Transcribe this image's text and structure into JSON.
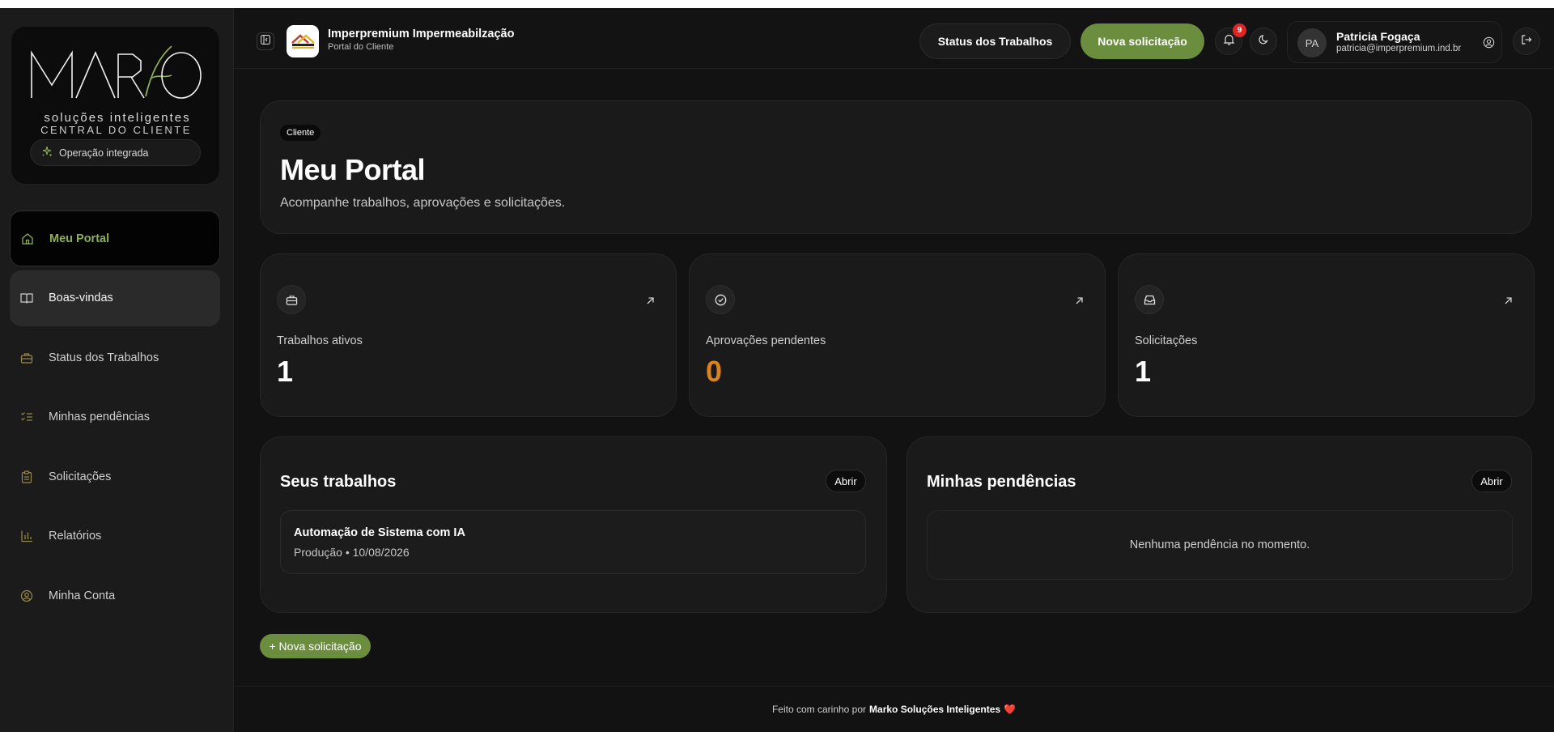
{
  "sidebar": {
    "brand": {
      "logo_text": "MARKO",
      "tagline": "soluções inteligentes",
      "central_label": "CENTRAL DO CLIENTE",
      "status_pill": "Operação integrada"
    },
    "items": [
      {
        "label": "Meu Portal",
        "icon": "home-icon",
        "active": true
      },
      {
        "label": "Boas-vindas",
        "icon": "book-open-icon",
        "hover": true
      },
      {
        "label": "Status dos Trabalhos",
        "icon": "briefcase-icon"
      },
      {
        "label": "Minhas pendências",
        "icon": "list-checks-icon"
      },
      {
        "label": "Solicitações",
        "icon": "clipboard-icon"
      },
      {
        "label": "Relatórios",
        "icon": "bar-chart-icon"
      },
      {
        "label": "Minha Conta",
        "icon": "user-circle-icon"
      }
    ]
  },
  "header": {
    "company_name": "Imperpremium Impermeabilzação",
    "company_sub": "Portal do Cliente",
    "status_button": "Status dos Trabalhos",
    "new_request_button": "Nova solicitação",
    "notifications_count": "9",
    "user": {
      "initials": "PA",
      "name": "Patricia Fogaça",
      "email": "patricia@imperpremium.ind.br"
    }
  },
  "hero": {
    "chip": "Cliente",
    "title": "Meu Portal",
    "subtitle": "Acompanhe trabalhos, aprovações e solicitações."
  },
  "stats": [
    {
      "label": "Trabalhos ativos",
      "value": "1",
      "icon": "briefcase-icon"
    },
    {
      "label": "Aprovações pendentes",
      "value": "0",
      "icon": "check-circle-icon"
    },
    {
      "label": "Solicitações",
      "value": "1",
      "icon": "inbox-icon"
    }
  ],
  "jobs_panel": {
    "title": "Seus trabalhos",
    "open_button": "Abrir",
    "items": [
      {
        "title": "Automação de Sistema com IA",
        "meta": "Produção • 10/08/2026"
      }
    ]
  },
  "pending_panel": {
    "title": "Minhas pendências",
    "open_button": "Abrir",
    "empty_text": "Nenhuma pendência no momento."
  },
  "bottom_button": "+ Nova solicitação",
  "footer": {
    "prefix": "Feito com carinho por",
    "brand": "Marko Soluções Inteligentes",
    "heart": "❤️"
  },
  "colors": {
    "accent_green": "#6b8e3e",
    "active_nav_text": "#8fae5a",
    "warning_orange": "#d9831e",
    "badge_red": "#e02424"
  }
}
